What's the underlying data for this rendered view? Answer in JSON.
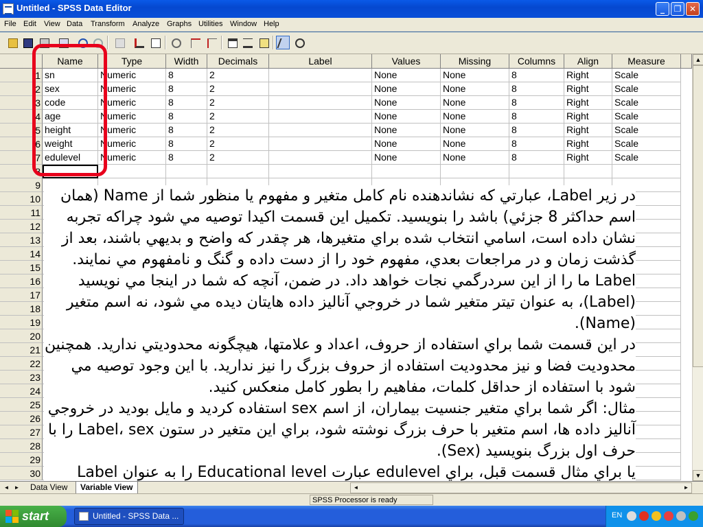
{
  "window": {
    "title": "Untitled - SPSS Data Editor"
  },
  "menu": [
    "File",
    "Edit",
    "View",
    "Data",
    "Transform",
    "Analyze",
    "Graphs",
    "Utilities",
    "Window",
    "Help"
  ],
  "columns": [
    "Name",
    "Type",
    "Width",
    "Decimals",
    "Label",
    "Values",
    "Missing",
    "Columns",
    "Align",
    "Measure"
  ],
  "variables": [
    [
      "sn",
      "Numeric",
      "8",
      "2",
      "",
      "None",
      "None",
      "8",
      "Right",
      "Scale"
    ],
    [
      "sex",
      "Numeric",
      "8",
      "2",
      "",
      "None",
      "None",
      "8",
      "Right",
      "Scale"
    ],
    [
      "code",
      "Numeric",
      "8",
      "2",
      "",
      "None",
      "None",
      "8",
      "Right",
      "Scale"
    ],
    [
      "age",
      "Numeric",
      "8",
      "2",
      "",
      "None",
      "None",
      "8",
      "Right",
      "Scale"
    ],
    [
      "height",
      "Numeric",
      "8",
      "2",
      "",
      "None",
      "None",
      "8",
      "Right",
      "Scale"
    ],
    [
      "weight",
      "Numeric",
      "8",
      "2",
      "",
      "None",
      "None",
      "8",
      "Right",
      "Scale"
    ],
    [
      "edulevel",
      "Numeric",
      "8",
      "2",
      "",
      "None",
      "None",
      "8",
      "Right",
      "Scale"
    ]
  ],
  "row_numbers": [
    "1",
    "2",
    "3",
    "4",
    "5",
    "6",
    "7",
    "8",
    "9",
    "10",
    "11",
    "12",
    "13",
    "14",
    "15",
    "16",
    "17",
    "18",
    "19",
    "20",
    "21",
    "22",
    "23",
    "24",
    "25",
    "26",
    "27",
    "28",
    "29",
    "30"
  ],
  "annotation": {
    "paragraphs": [
      "در زير Label، عبارتي كه نشاندهنده نام كامل متغير و مفهوم يا منظور شما از Name (همان اسم حداكثر 8 جزئي) باشد را بنويسيد. تكميل اين قسمت اكيدا توصيه مي شود چراكه تجربه نشان داده است، اسامي انتخاب شده براي متغيرها، هر چقدر كه واضح و بديهي باشند، بعد از گذشت زمان و در مراجعات بعدي، مفهوم خود را از دست داده و گنگ و نامفهوم مي نمايند. Label ما را از اين سردرگمي نجات خواهد داد. در ضمن، آنچه كه شما در اينجا مي نويسيد (Label)، به عنوان تيتر متغير شما در خروجي آناليز داده هايتان ديده مي شود، نه اسم متغير (Name).",
      "در اين قسمت شما براي استفاده از حروف، اعداد و علامتها، هيچگونه محدوديتي نداريد. همچنين محدوديت فضا و نيز محدوديت استفاده از حروف بزرگ را نيز نداريد. با اين وجود توصيه مي شود با استفاده از حداقل كلمات، مفاهيم را بطور كامل منعكس كنيد.",
      "مثال: اگر شما براي متغير جنسيت بيماران، از اسم sex استفاده كرديد و مايل بوديد در خروجي آناليز داده ها، اسم متغير با حرف بزرگ نوشته شود، براي اين متغير در ستون Label، sex را با حرف اول بزرگ بنويسيد (Sex).",
      "يا براي مثال قسمت قبل، براي edulevel عبارت Educational level را به عنوان Label برگزينيد."
    ]
  },
  "tabs": [
    "Data View",
    "Variable View"
  ],
  "active_tab": "Variable View",
  "status": {
    "text": "SPSS Processor  is ready"
  },
  "taskbar": {
    "start_label": "start",
    "task_label": "Untitled - SPSS Data ...",
    "lang": "EN"
  },
  "colors": {
    "highlight_box": "#e8001c",
    "titlebar": "#0a5ae8",
    "taskbar": "#245edb"
  }
}
